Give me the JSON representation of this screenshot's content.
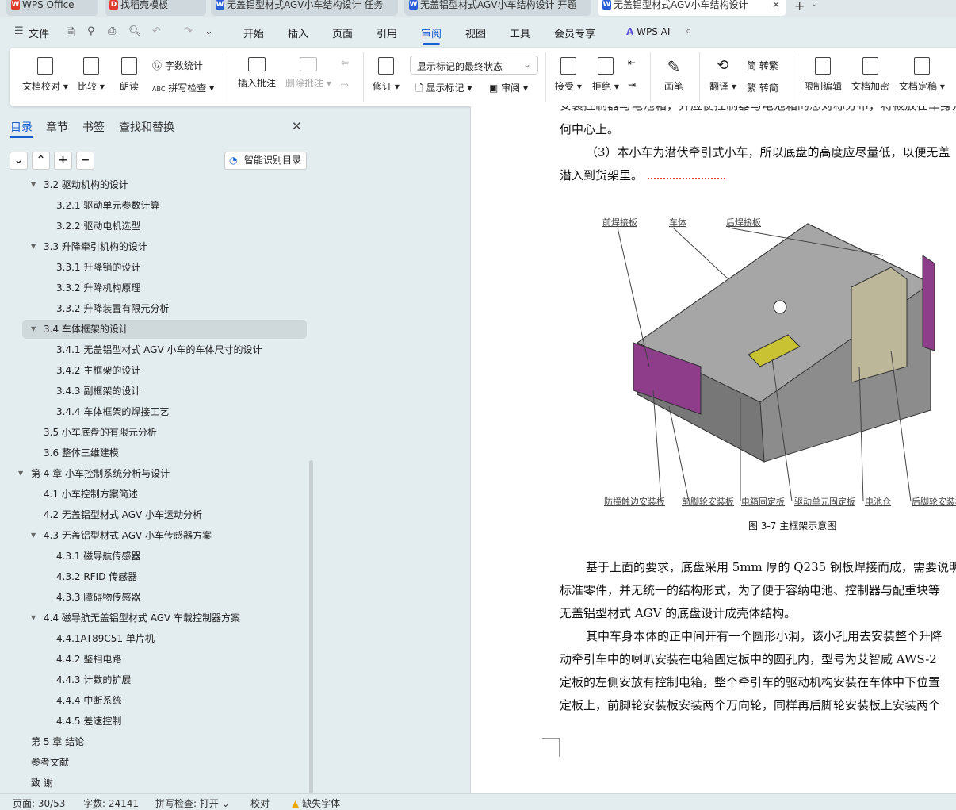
{
  "tabs": [
    {
      "label": "WPS Office",
      "icon": "wps-logo-icon",
      "color": "#e03a2f"
    },
    {
      "label": "找稻壳模板",
      "icon": "docer-icon",
      "color": "#e03a2f"
    },
    {
      "label": "无盖铝型材式AGV小车结构设计 任务",
      "icon": "word-doc-icon",
      "color": "#2b5fd9"
    },
    {
      "label": "无盖铝型材式AGV小车结构设计 开题",
      "icon": "word-doc-icon",
      "color": "#2b5fd9"
    },
    {
      "label": "无盖铝型材式AGV小车结构设计",
      "icon": "word-doc-icon",
      "color": "#2b5fd9",
      "active": true
    }
  ],
  "menu": {
    "file": "文件",
    "items": [
      "开始",
      "插入",
      "页面",
      "引用",
      "审阅",
      "视图",
      "工具",
      "会员专享"
    ],
    "active": "审阅",
    "ai": "WPS AI"
  },
  "ribbon": {
    "doc_check": "文档校对",
    "compare": "比较",
    "read_aloud": "朗读",
    "word_count": "字数统计",
    "spell_check": "拼写检查",
    "insert_comment": "插入批注",
    "delete_comment": "删除批注",
    "revise": "修订",
    "markup_state": "显示标记的最终状态",
    "show_markup": "显示标记",
    "review": "审阅",
    "accept": "接受",
    "reject": "拒绝",
    "pen": "画笔",
    "translate": "翻译",
    "to_traditional": "转繁",
    "to_simplified": "转简",
    "restrict_edit": "限制编辑",
    "encrypt": "文档加密",
    "finalize": "文档定稿"
  },
  "panel": {
    "tabs": [
      "目录",
      "章节",
      "书签",
      "查找和替换"
    ],
    "smart_toc": "智能识别目录",
    "toc": [
      {
        "text": "3.2  驱动机构的设计",
        "level": 2,
        "arrow": true
      },
      {
        "text": "3.2.1  驱动单元参数计算",
        "level": 3
      },
      {
        "text": "3.2.2  驱动电机选型",
        "level": 3
      },
      {
        "text": "3.3  升降牵引机构的设计",
        "level": 2,
        "arrow": true
      },
      {
        "text": "3.3.1 升降销的设计",
        "level": 3
      },
      {
        "text": "3.3.2  升降机构原理",
        "level": 3
      },
      {
        "text": "3.3.2  升降装置有限元分析",
        "level": 3
      },
      {
        "text": "3.4  车体框架的设计",
        "level": 2,
        "arrow": true,
        "selected": true
      },
      {
        "text": "3.4.1  无盖铝型材式 AGV 小车的车体尺寸的设计",
        "level": 3
      },
      {
        "text": "3.4.2  主框架的设计",
        "level": 3
      },
      {
        "text": "3.4.3  副框架的设计",
        "level": 3
      },
      {
        "text": "3.4.4  车体框架的焊接工艺",
        "level": 3
      },
      {
        "text": "3.5 小车底盘的有限元分析",
        "level": 2
      },
      {
        "text": "3.6  整体三维建模",
        "level": 2
      },
      {
        "text": "第 4 章  小车控制系统分析与设计",
        "level": 1,
        "arrow": true
      },
      {
        "text": "4.1  小车控制方案简述",
        "level": 2
      },
      {
        "text": "4.2  无盖铝型材式 AGV 小车运动分析",
        "level": 2
      },
      {
        "text": "4.3  无盖铝型材式 AGV 小车传感器方案",
        "level": 2,
        "arrow": true
      },
      {
        "text": "4.3.1 磁导航传感器",
        "level": 3
      },
      {
        "text": "4.3.2 RFID 传感器",
        "level": 3
      },
      {
        "text": "4.3.3  障碍物传感器",
        "level": 3
      },
      {
        "text": "4.4  磁导航无盖铝型材式 AGV 车载控制器方案",
        "level": 2,
        "arrow": true
      },
      {
        "text": "4.4.1AT89C51 单片机",
        "level": 3
      },
      {
        "text": "4.4.2 鉴相电路",
        "level": 3
      },
      {
        "text": "4.4.3 计数的扩展",
        "level": 3
      },
      {
        "text": "4.4.4  中断系统",
        "level": 3
      },
      {
        "text": "4.4.5  差速控制",
        "level": 3
      },
      {
        "text": "第 5 章   结论",
        "level": 1
      },
      {
        "text": "参考文献",
        "level": 1
      },
      {
        "text": "致   谢",
        "level": 1
      }
    ]
  },
  "doc": {
    "top_cut": "安装控制器与电池箱，并应使控制器与电池箱的总对称分布，将被放在车身几",
    "p1_end": "何中心上。",
    "p2": "（3）本小车为潜伏牵引式小车，所以底盘的高度应尽量低，以便无盖",
    "p2_end": "潜入到货架里。",
    "figure_labels_top": [
      "前焊接板",
      "车体",
      "后焊接板"
    ],
    "figure_labels_bottom": [
      "防撞触边安装板",
      "前脚轮安装板",
      "电箱固定板",
      "驱动单元固定板",
      "电池仓",
      "后脚轮安装板"
    ],
    "caption": "图 3-7  主框架示意图",
    "p3": [
      "基于上面的要求，底盘采用 5mm 厚的 Q235 钢板焊接而成，需要说明",
      "标准零件，并无统一的结构形式，为了便于容纳电池、控制器与配重块等",
      "无盖铝型材式 AGV 的底盘设计成壳体结构。"
    ],
    "p4": [
      "其中车身本体的正中间开有一个圆形小洞，该小孔用去安装整个升降",
      "动牵引车中的喇叭安装在电箱固定板中的圆孔内，型号为艾智威 AWS-2",
      "定板的左侧安放有控制电箱，整个牵引车的驱动机构安装在车体中下位置",
      "定板上，前脚轮安装板安装两个万向轮，同样再后脚轮安装板上安装两个"
    ]
  },
  "status": {
    "page": "页面: 30/53",
    "words": "字数: 24141",
    "spell": "拼写检查: 打开",
    "proof": "校对",
    "missing_font": "缺失字体"
  }
}
